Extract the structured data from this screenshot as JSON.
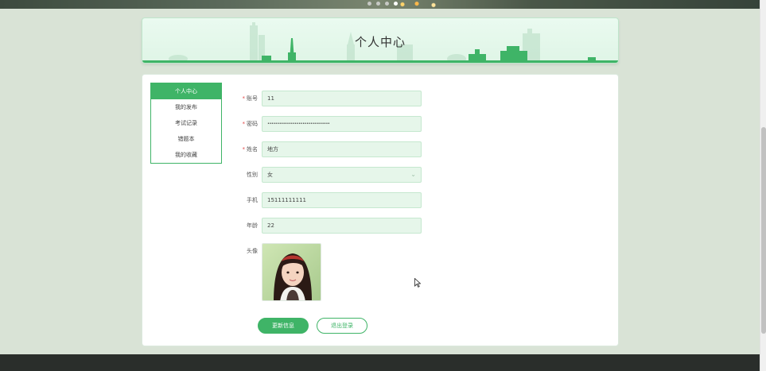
{
  "page": {
    "title": "个人中心"
  },
  "sidebar": {
    "items": [
      {
        "label": "个人中心",
        "active": true
      },
      {
        "label": "我的发布",
        "active": false
      },
      {
        "label": "考试记录",
        "active": false
      },
      {
        "label": "错题本",
        "active": false
      },
      {
        "label": "我的收藏",
        "active": false
      }
    ]
  },
  "form": {
    "account": {
      "label": "账号",
      "required": true,
      "value": "11"
    },
    "password": {
      "label": "密码",
      "required": true,
      "value": "••••••••••••••••••••••••••••••••"
    },
    "name": {
      "label": "姓名",
      "required": true,
      "value": "地方"
    },
    "gender": {
      "label": "性别",
      "required": false,
      "value": "女"
    },
    "phone": {
      "label": "手机",
      "required": false,
      "value": "15111111111"
    },
    "age": {
      "label": "年龄",
      "required": false,
      "value": "22"
    },
    "avatar": {
      "label": "头像"
    }
  },
  "buttons": {
    "update": "更新信息",
    "logout": "退出登录"
  },
  "colors": {
    "accent": "#3fb467",
    "input_bg": "#e6f6ea",
    "page_bg": "#d9e3d6",
    "footer_bg": "#2a2e2b"
  }
}
